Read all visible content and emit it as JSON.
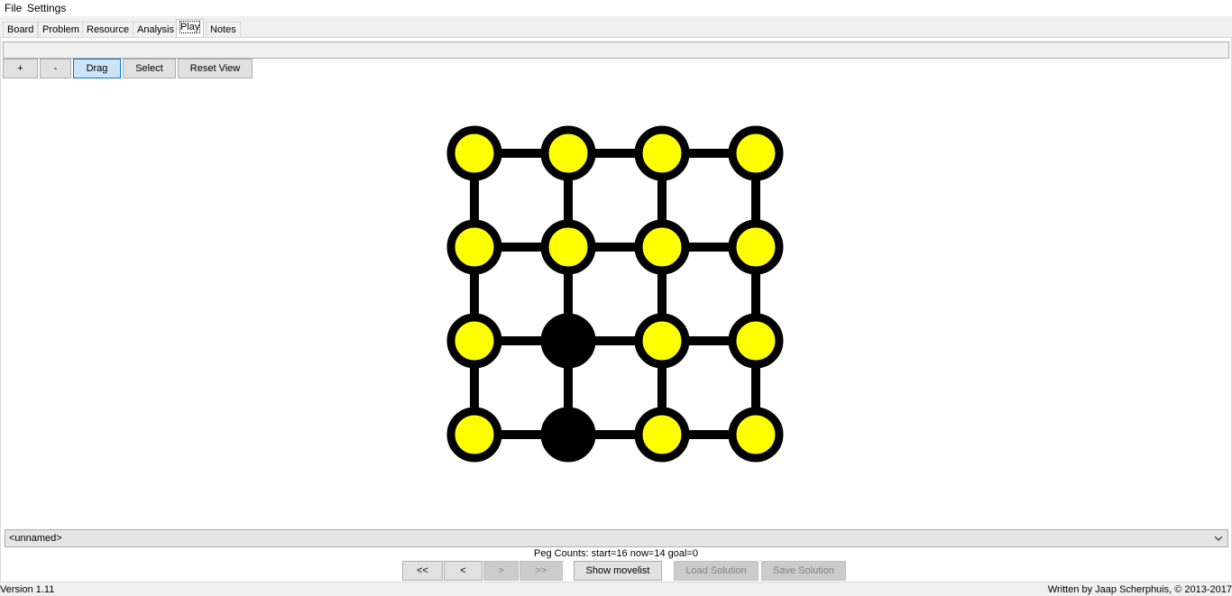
{
  "menu": {
    "file": "File",
    "settings": "Settings"
  },
  "tabs": [
    "Board",
    "Problem",
    "Resource",
    "Analysis",
    "Play",
    "Notes"
  ],
  "active_tab": "Play",
  "toolbar": {
    "zoom_in": "+",
    "zoom_out": "-",
    "drag": "Drag",
    "select": "Select",
    "reset_view": "Reset View"
  },
  "board": {
    "grid_size": 4,
    "cells": [
      [
        1,
        1,
        1,
        1
      ],
      [
        1,
        1,
        1,
        1
      ],
      [
        1,
        0,
        1,
        1
      ],
      [
        1,
        0,
        1,
        1
      ]
    ],
    "colors": {
      "peg": "#ffff00",
      "hole": "#000000",
      "line": "#000000"
    }
  },
  "solution_name": "<unnamed>",
  "peg_counts": "Peg Counts: start=16  now=14  goal=0",
  "nav": {
    "first": "<<",
    "prev": "<",
    "next": ">",
    "last": ">>",
    "show_movelist": "Show movelist",
    "load_solution": "Load Solution",
    "save_solution": "Save Solution"
  },
  "footer": {
    "version": "Version 1.11",
    "credits": "Written by Jaap Scherphuis, © 2013-2017"
  }
}
